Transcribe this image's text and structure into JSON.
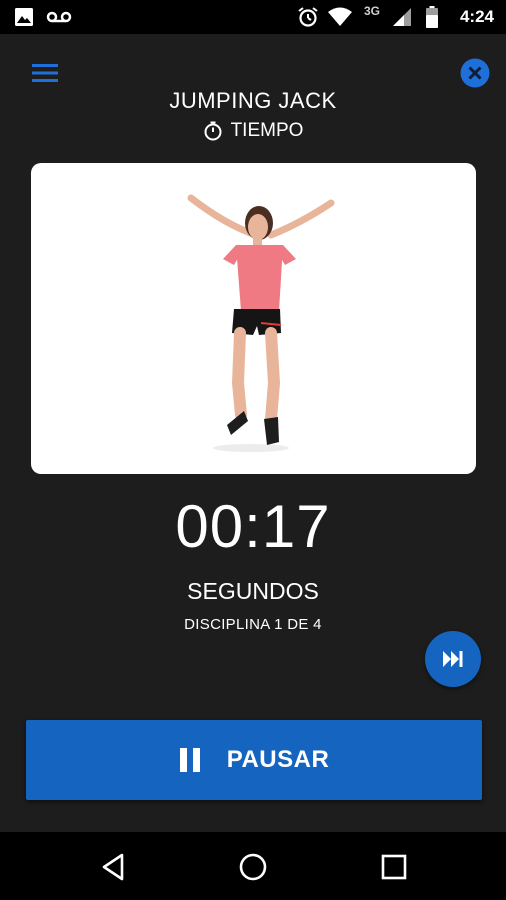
{
  "status_bar": {
    "time": "4:24",
    "network": "3G",
    "icons": [
      "image-icon",
      "voicemail-icon",
      "alarm-icon",
      "wifi-icon",
      "cellular-signal-icon",
      "battery-icon"
    ]
  },
  "header": {
    "title": "JUMPING JACK",
    "mode_label": "TIEMPO",
    "icons": [
      "menu-icon",
      "close-icon",
      "timer-icon"
    ]
  },
  "workout": {
    "timer": "00:17",
    "unit": "SEGUNDOS",
    "progress": "DISCIPLINA 1 DE 4"
  },
  "actions": {
    "pause_label": "PAUSAR",
    "icons": [
      "skip-next-icon",
      "pause-icon"
    ]
  },
  "nav_bar": {
    "icons": [
      "back-icon",
      "home-icon",
      "recents-icon"
    ]
  },
  "colors": {
    "background": "#1d1d1d",
    "accent": "#1565c0",
    "system_bar": "#000000"
  }
}
